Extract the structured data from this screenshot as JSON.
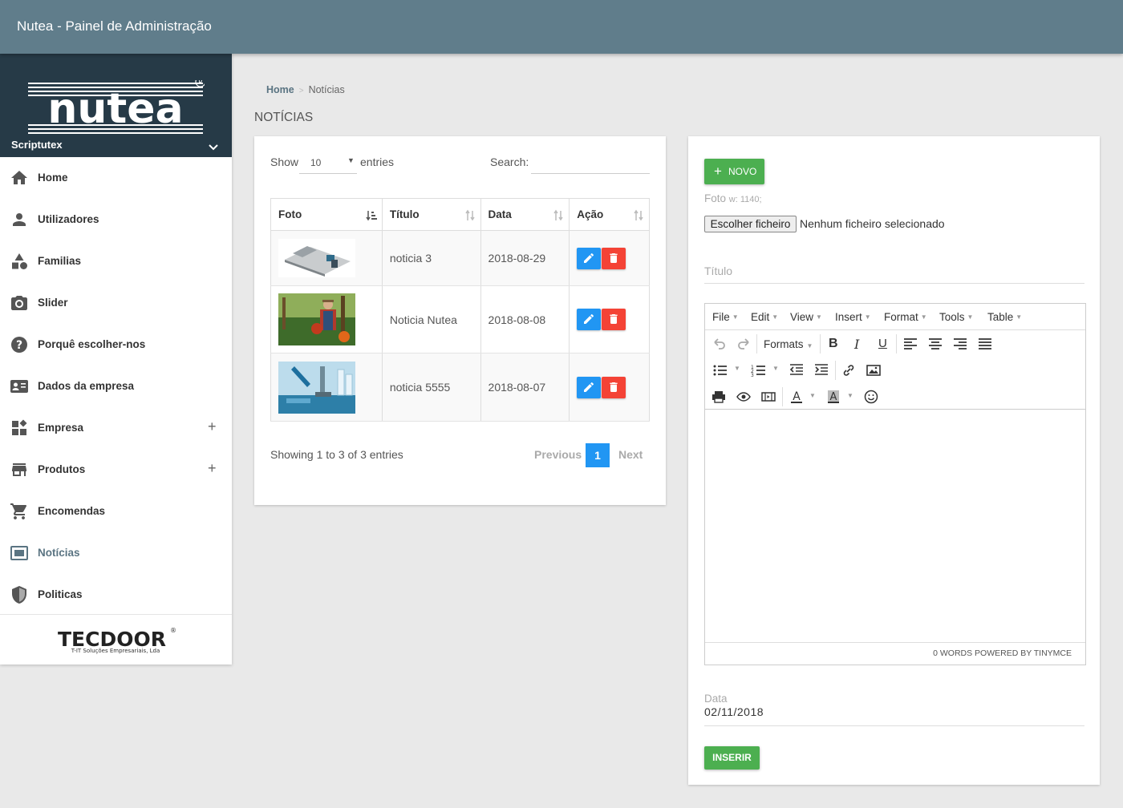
{
  "header": {
    "title": "Nutea - Painel de Administração"
  },
  "sidebar": {
    "logo_text": "nutea",
    "user": "Scriptutex",
    "items": [
      {
        "label": "Home",
        "icon": "home-icon"
      },
      {
        "label": "Utilizadores",
        "icon": "person-icon"
      },
      {
        "label": "Familias",
        "icon": "shapes-icon"
      },
      {
        "label": "Slider",
        "icon": "camera-icon"
      },
      {
        "label": "Porquê escolher-nos",
        "icon": "help-icon"
      },
      {
        "label": "Dados da empresa",
        "icon": "contact-card-icon"
      },
      {
        "label": "Empresa",
        "icon": "widgets-icon",
        "expandable": "+"
      },
      {
        "label": "Produtos",
        "icon": "store-icon",
        "expandable": "+"
      },
      {
        "label": "Encomendas",
        "icon": "cart-icon"
      },
      {
        "label": "Notícias",
        "icon": "monitor-icon",
        "active": true
      },
      {
        "label": "Politicas",
        "icon": "shield-icon"
      }
    ],
    "footer_brand": "TECDOOR",
    "footer_sub": "T-IT Soluções Empresariais, Lda"
  },
  "breadcrumb": {
    "home": "Home",
    "current": "Notícias"
  },
  "page_title": "NOTÍCIAS",
  "table_card": {
    "show_label": "Show",
    "entries_value": "10",
    "entries_label": "entries",
    "search_label": "Search:",
    "columns": [
      "Foto",
      "Título",
      "Data",
      "Ação"
    ],
    "rows": [
      {
        "titulo": "noticia 3",
        "data": "2018-08-29"
      },
      {
        "titulo": "Noticia Nutea",
        "data": "2018-08-08"
      },
      {
        "titulo": "noticia 5555",
        "data": "2018-08-07"
      }
    ],
    "info": "Showing 1 to 3 of 3 entries",
    "pager": {
      "previous": "Previous",
      "page": "1",
      "next": "Next"
    }
  },
  "form_card": {
    "novo_label": "NOVO",
    "foto_label": "Foto",
    "foto_hint": "w: 1140;",
    "file_button": "Escolher ficheiro",
    "file_status": "Nenhum ficheiro selecionado",
    "titulo_placeholder": "Título",
    "editor": {
      "menus": [
        "File",
        "Edit",
        "View",
        "Insert",
        "Format",
        "Tools",
        "Table"
      ],
      "formats_label": "Formats",
      "status": "0 WORDS POWERED BY TINYMCE"
    },
    "data_label": "Data",
    "data_value": "02/11/2018",
    "inserir_label": "INSERIR"
  },
  "colors": {
    "topbar": "#607d8b",
    "brand": "#263a47",
    "primary": "#2196f3",
    "danger": "#f44336",
    "success": "#4caf50"
  }
}
